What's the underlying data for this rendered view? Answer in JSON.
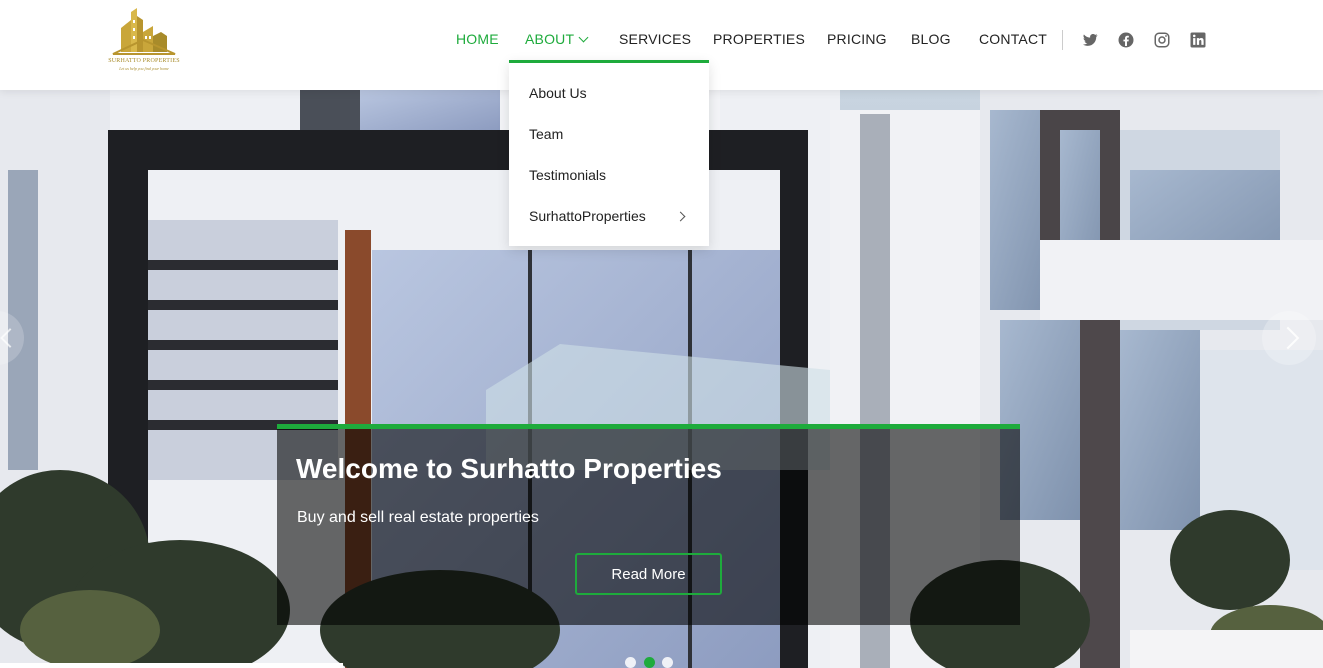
{
  "brand": {
    "name": "SURHATTO PROPERTIES",
    "tagline": "Let us help you find your home"
  },
  "nav": {
    "items": [
      {
        "label": "HOME",
        "active": true
      },
      {
        "label": "ABOUT",
        "active": true,
        "has_dropdown": true
      },
      {
        "label": "SERVICES"
      },
      {
        "label": "PROPERTIES"
      },
      {
        "label": "PRICING"
      },
      {
        "label": "BLOG"
      },
      {
        "label": "CONTACT"
      }
    ],
    "social": [
      "twitter-icon",
      "facebook-icon",
      "instagram-icon",
      "linkedin-icon"
    ]
  },
  "dropdown": {
    "items": [
      {
        "label": "About Us"
      },
      {
        "label": "Team"
      },
      {
        "label": "Testimonials"
      },
      {
        "label": "SurhattoProperties",
        "has_submenu": true
      }
    ]
  },
  "hero": {
    "title": "Welcome to Surhatto Properties",
    "subtitle": "Buy and sell real estate properties",
    "button_label": "Read More",
    "slides": 3,
    "active_slide": 2
  },
  "colors": {
    "accent": "#1eab3c",
    "brand_gold": "#a88b2a",
    "text": "#222222"
  }
}
